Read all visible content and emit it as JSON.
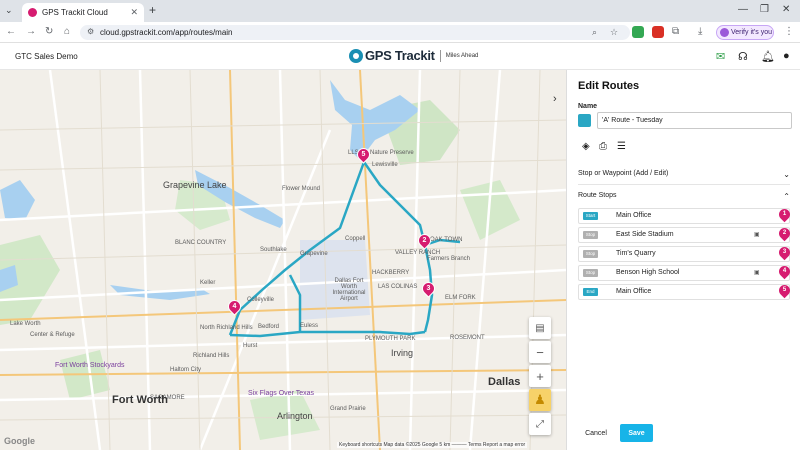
{
  "browser": {
    "tab_title": "GPS Trackit Cloud",
    "url": "cloud.gpstrackit.com/app/routes/main",
    "verify_label": "Verify it's you"
  },
  "header": {
    "org_name": "GTC Sales Demo",
    "logo_text": "GPS Trackit",
    "logo_tagline": "Miles Ahead"
  },
  "map": {
    "labels": {
      "fort_worth": "Fort Worth",
      "dallas": "Dallas",
      "irving": "Irving",
      "arlington": "Arlington",
      "grapevine": "Grapevine",
      "coppell": "Coppell",
      "southlake": "Southlake",
      "colleyville": "Colleyville",
      "bedford": "Bedford",
      "hurst": "Hurst",
      "euless": "Euless",
      "keller": "Keller",
      "flower_mound": "Flower Mound",
      "lewisville": "Lewisville",
      "valley_ranch": "VALLEY RANCH",
      "farmers_branch": "Farmers Branch",
      "las_colinas": "LAS COLINAS",
      "grapevine_lake": "Grapevine Lake",
      "richland_hills": "Richland Hills",
      "north_richland_hills": "North Richland Hills",
      "haltom_city": "Haltom City",
      "dfw_airport": "Dallas Fort Worth International Airport",
      "stockyards": "Fort Worth Stockyards",
      "six_flags": "Six Flags Over Texas",
      "lsb": "LLSB & Nature Preserve",
      "hackberry": "HACKBERRY",
      "plymouth_park": "PLYMOUTH PARK",
      "grand_prairie": "Grand Prairie",
      "sagamore": "SAGAMORE",
      "lake_worth": "Lake Worth",
      "elm_fork": "ELM FORK",
      "dfw_refuge": "Center & Refuge",
      "rosemont": "ROSEMONT",
      "oak_town": "OAK TOWN",
      "blanc_country": "BLANC COUNTRY"
    },
    "attribution": "Keyboard shortcuts   Map data ©2025 Google   5 km ———   Terms   Report a map error",
    "google": "Google"
  },
  "panel": {
    "title": "Edit Routes",
    "name_label": "Name",
    "route_name": "'A' Route - Tuesday",
    "route_color": "#2aa7c4",
    "waypoint_section": "Stop or Waypoint (Add / Edit)",
    "stops_section": "Route Stops",
    "stops": [
      {
        "badge": "Start",
        "name": "Main Office",
        "number": "1",
        "badge_color": "#2aa7c4",
        "has_note": false
      },
      {
        "badge": "Stop",
        "name": "East Side Stadium",
        "number": "2",
        "badge_color": "#b0b0b0",
        "has_note": true
      },
      {
        "badge": "Stop",
        "name": "Tim's Quarry",
        "number": "3",
        "badge_color": "#b0b0b0",
        "has_note": false
      },
      {
        "badge": "Stop",
        "name": "Benson High School",
        "number": "4",
        "badge_color": "#b0b0b0",
        "has_note": true
      },
      {
        "badge": "End",
        "name": "Main Office",
        "number": "5",
        "badge_color": "#2aa7c4",
        "has_note": false
      }
    ],
    "cancel_label": "Cancel",
    "save_label": "Save"
  },
  "markers": [
    "5",
    "2",
    "3",
    "4"
  ],
  "colors": {
    "accent": "#17b4e8",
    "marker": "#d61c70",
    "route_line": "#2aa7c4"
  }
}
